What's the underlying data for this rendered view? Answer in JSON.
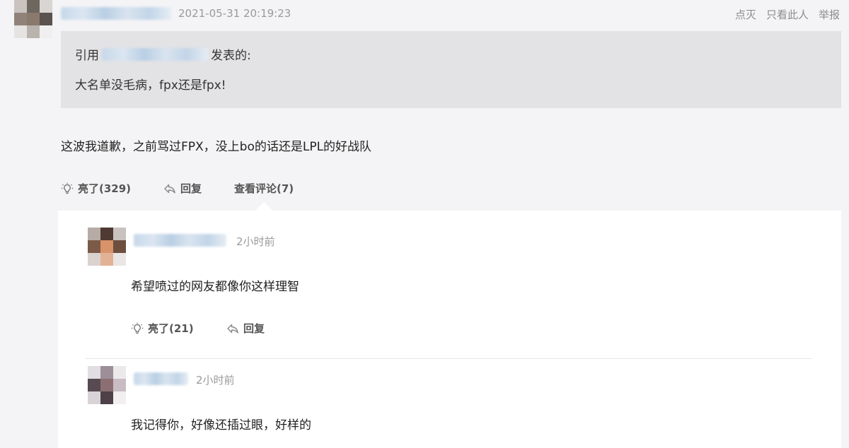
{
  "post": {
    "timestamp": "2021-05-31 20:19:23",
    "actions": {
      "dislike": "点灭",
      "only_this_user": "只看此人",
      "report": "举报"
    },
    "quote": {
      "prefix": "引用",
      "suffix": "发表的:",
      "text": "大名单没毛病，fpx还是fpx!"
    },
    "text": "这波我道歉，之前骂过FPX，没上bo的话还是LPL的好战队",
    "like_label": "亮了(329)",
    "reply_label": "回复",
    "view_comments_label": "查看评论(7)"
  },
  "replies": [
    {
      "time": "2小时前",
      "text": "希望喷过的网友都像你这样理智",
      "like_label": "亮了(21)",
      "reply_label": "回复"
    },
    {
      "time": "2小时前",
      "text": "我记得你，好像还插过眼，好样的"
    }
  ],
  "colors": {
    "page_bg": "#f4f4f6",
    "quote_bg": "#e3e3e5",
    "panel_bg": "#ffffff",
    "muted_text": "#9a9a9a",
    "action_text": "#555555"
  },
  "icons": {
    "like": "lightbulb-icon",
    "reply": "reply-arrow-icon"
  }
}
